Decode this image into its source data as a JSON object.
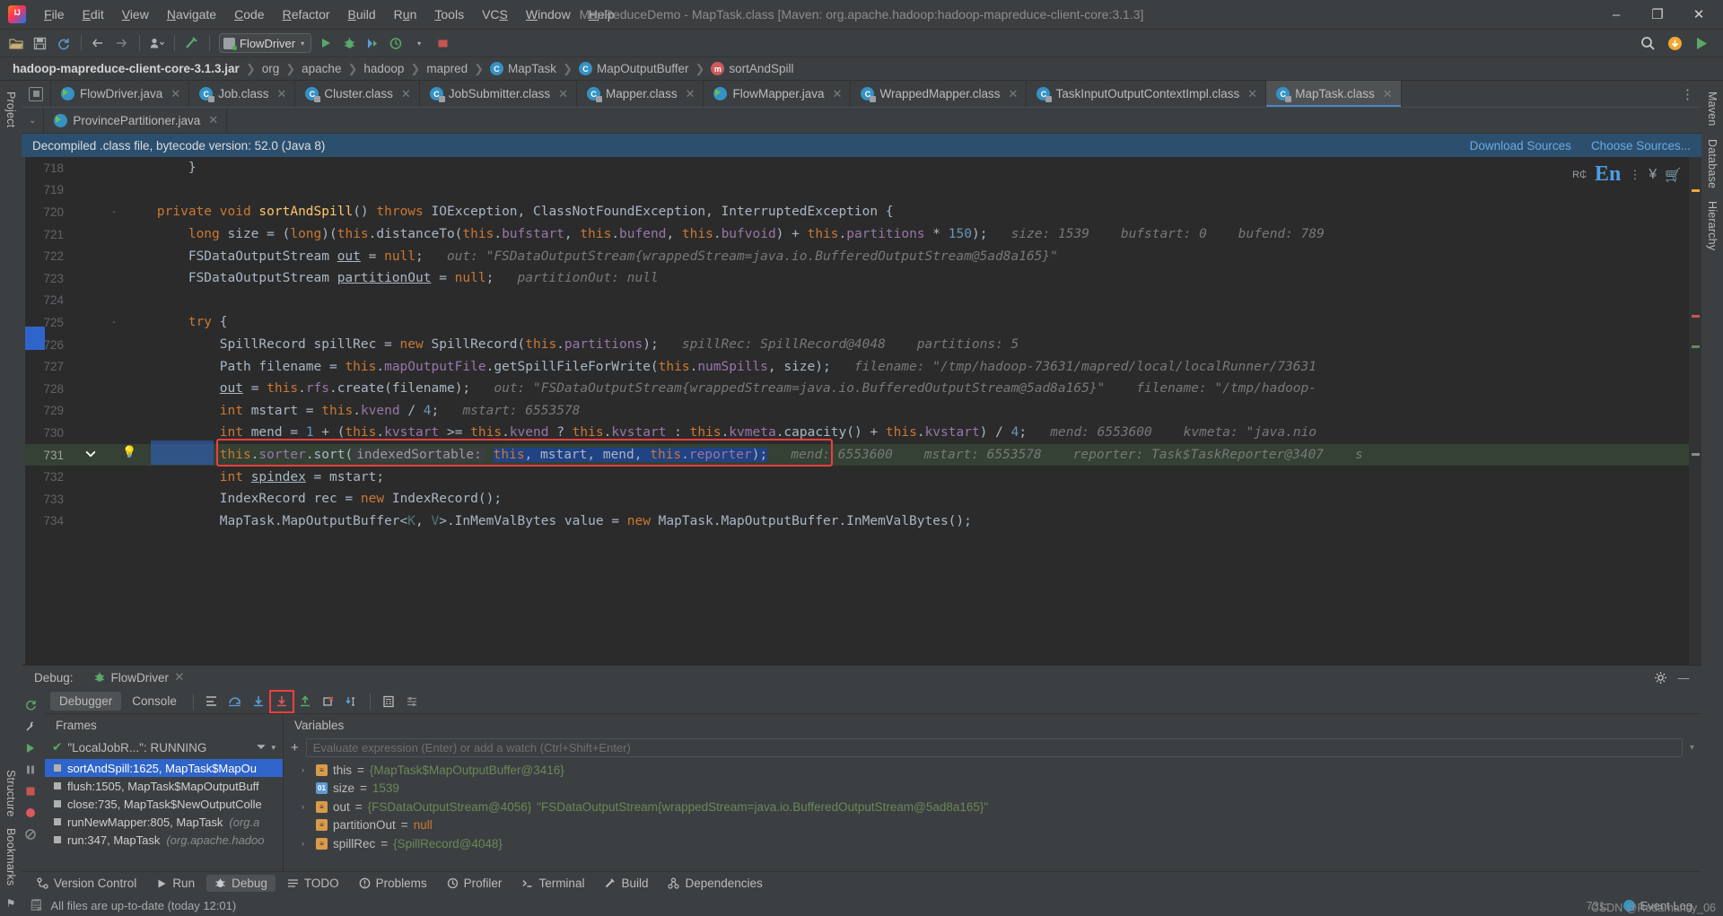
{
  "window": {
    "title": "MapReduceDemo - MapTask.class [Maven: org.apache.hadoop:hadoop-mapreduce-client-core:3.1.3]",
    "minimize": "–",
    "maximize": "❐",
    "close": "✕"
  },
  "menubar": [
    {
      "label": "File"
    },
    {
      "label": "Edit"
    },
    {
      "label": "View"
    },
    {
      "label": "Navigate"
    },
    {
      "label": "Code"
    },
    {
      "label": "Refactor"
    },
    {
      "label": "Build"
    },
    {
      "label": "Run"
    },
    {
      "label": "Tools"
    },
    {
      "label": "VCS"
    },
    {
      "label": "Window"
    },
    {
      "label": "Help"
    }
  ],
  "toolbar": {
    "run_config": "FlowDriver",
    "caret": "▾",
    "icons": [
      "open-folder-icon",
      "save-icon",
      "sync-icon",
      "back-arrow-icon",
      "forward-arrow-icon",
      "profile-icon",
      "build-hammer-icon",
      "run-icon",
      "debug-icon",
      "run-coverage-icon",
      "profiler-icon",
      "stop-icon"
    ],
    "search_icon": "⌕",
    "updates_icon": "↓",
    "plugin_icon": "▶"
  },
  "breadcrumb": [
    {
      "label": "hadoop-mapreduce-client-core-3.1.3.jar",
      "icon": null,
      "bold": true
    },
    {
      "label": "org",
      "icon": null,
      "bold": false
    },
    {
      "label": "apache",
      "icon": null,
      "bold": false
    },
    {
      "label": "hadoop",
      "icon": null,
      "bold": false
    },
    {
      "label": "mapred",
      "icon": null,
      "bold": false
    },
    {
      "label": "MapTask",
      "icon": "class-icon",
      "bold": false
    },
    {
      "label": "MapOutputBuffer",
      "icon": "class-icon",
      "bold": false
    },
    {
      "label": "sortAndSpill",
      "icon": "method-icon",
      "bold": false
    }
  ],
  "tabs_row1": [
    {
      "label": "FlowDriver.java",
      "icon": "java-file-icon",
      "active": false
    },
    {
      "label": "Job.class",
      "icon": "class-file-icon",
      "active": false
    },
    {
      "label": "Cluster.class",
      "icon": "class-file-icon",
      "active": false
    },
    {
      "label": "JobSubmitter.class",
      "icon": "class-file-icon",
      "active": false
    },
    {
      "label": "Mapper.class",
      "icon": "class-file-icon",
      "active": false
    },
    {
      "label": "FlowMapper.java",
      "icon": "java-file-icon",
      "active": false
    },
    {
      "label": "WrappedMapper.class",
      "icon": "class-file-icon",
      "active": false
    },
    {
      "label": "TaskInputOutputContextImpl.class",
      "icon": "class-file-icon",
      "active": false
    },
    {
      "label": "MapTask.class",
      "icon": "class-file-icon",
      "active": true
    }
  ],
  "tabs_row2": [
    {
      "label": "ProvincePartitioner.java",
      "icon": "java-file-icon",
      "active": false
    }
  ],
  "tabs_overflow_icon": "⋮",
  "notice": {
    "text": "Decompiled .class file, bytecode version: 52.0 (Java 8)",
    "link_download": "Download Sources",
    "link_choose": "Choose Sources..."
  },
  "editor": {
    "first_line_no": 718,
    "lines": [
      {
        "n": 718,
        "fold": "",
        "html": "        }"
      },
      {
        "n": 719,
        "fold": "",
        "html": ""
      },
      {
        "n": 720,
        "fold": "-",
        "html": "    <span class='kw'>private</span> <span class='kw'>void</span> <span class='fn'>sortAndSpill</span>() <span class='kw'>throws</span> IOException, ClassNotFoundException, InterruptedException {"
      },
      {
        "n": 721,
        "fold": "",
        "html": "        <span class='kw'>long</span> size = (<span class='kw'>long</span>)(<span class='kw'>this</span>.distanceTo(<span class='kw'>this</span>.<span class='fld'>bufstart</span>, <span class='kw'>this</span>.<span class='fld'>bufend</span>, <span class='kw'>this</span>.<span class='fld'>bufvoid</span>) + <span class='kw'>this</span>.<span class='fld'>partitions</span> * <span class='num'>150</span>);   <span class='hint'>size: 1539    bufstart: 0    bufend: 789</span>"
      },
      {
        "n": 722,
        "fold": "",
        "html": "        FSDataOutputStream <span style='text-decoration:underline'>out</span> = <span class='kw'>null</span>;   <span class='hint'>out: \"FSDataOutputStream{wrappedStream=java.io.BufferedOutputStream@5ad8a165}\"</span>"
      },
      {
        "n": 723,
        "fold": "",
        "html": "        FSDataOutputStream <span style='text-decoration:underline'>partitionOut</span> = <span class='kw'>null</span>;   <span class='hint'>partitionOut: null</span>"
      },
      {
        "n": 724,
        "fold": "",
        "html": ""
      },
      {
        "n": 725,
        "fold": "-",
        "html": "        <span class='kw'>try</span> {"
      },
      {
        "n": 726,
        "fold": "",
        "html": "            SpillRecord spillRec = <span class='kw'>new</span> SpillRecord(<span class='kw'>this</span>.<span class='fld'>partitions</span>);   <span class='hint'>spillRec: SpillRecord@4048    partitions: 5</span>"
      },
      {
        "n": 727,
        "fold": "",
        "html": "            Path filename = <span class='kw'>this</span>.<span class='fld'>mapOutputFile</span>.getSpillFileForWrite(<span class='kw'>this</span>.<span class='fld'>numSpills</span>, size);   <span class='hint'>filename: \"/tmp/hadoop-73631/mapred/local/localRunner/73631</span>"
      },
      {
        "n": 728,
        "fold": "",
        "html": "            <span style='text-decoration:underline'>out</span> = <span class='kw'>this</span>.<span class='fld'>rfs</span>.create(filename);   <span class='hint'>out: \"FSDataOutputStream{wrappedStream=java.io.BufferedOutputStream@5ad8a165}\"    filename: \"/tmp/hadoop-</span>"
      },
      {
        "n": 729,
        "fold": "",
        "html": "            <span class='kw'>int</span> mstart = <span class='kw'>this</span>.<span class='fld'>kvend</span> / <span class='num'>4</span>;   <span class='hint'>mstart: 6553578</span>"
      },
      {
        "n": 730,
        "fold": "",
        "html": "            <span class='kw'>int</span> mend = <span class='num'>1</span> + (<span class='kw'>this</span>.<span class='fld'>kvstart</span> >= <span class='kw'>this</span>.<span class='fld'>kvend</span> ? <span class='kw'>this</span>.<span class='fld'>kvstart</span> : <span class='kw'>this</span>.<span class='fld'>kvmeta</span>.capacity() + <span class='kw'>this</span>.<span class='fld'>kvstart</span>) / <span class='num'>4</span>;   <span class='hint'>mend: 6553600    kvmeta: \"java.nio</span>"
      },
      {
        "n": 731,
        "fold": "",
        "highlight": true,
        "html": "            <span class='kw'>this</span>.<span class='fld'>sorter</span>.sort(<span class='hintbox'>indexedSortable:</span> <span class='selhl'><span class='kw'>this</span>, mstart, mend, <span class='kw'>this</span>.<span class='fld'>reporter</span>);</span>   <span class='hint'>mend: 6553600    mstart: 6553578    reporter: Task$TaskReporter@3407    s</span>"
      },
      {
        "n": 732,
        "fold": "",
        "html": "            <span class='kw'>int</span> <span style='text-decoration:underline'>spindex</span> = mstart;"
      },
      {
        "n": 733,
        "fold": "",
        "html": "            IndexRecord rec = <span class='kw'>new</span> IndexRecord();"
      },
      {
        "n": 734,
        "fold": "",
        "html": "            MapTask.MapOutputBuffer&lt;<span class='gen'>K</span>, <span class='gen'>V</span>&gt;.InMemValBytes value = <span class='kw'>new</span> MapTask.MapOutputBuffer.InMemValBytes();"
      }
    ],
    "float_badges": {
      "ime_prefix": "R₵",
      "ime": "En",
      "dots": "⋮",
      "yen": "¥",
      "cart": "🛒"
    }
  },
  "debug": {
    "label": "Debug:",
    "session": "FlowDriver",
    "tabs": [
      {
        "label": "Debugger",
        "active": true
      },
      {
        "label": "Console",
        "active": false
      }
    ],
    "toolbar_icons": [
      "show-execution-point-icon",
      "step-over-icon",
      "step-into-icon",
      "force-step-into-icon",
      "step-out-icon",
      "drop-frame-icon",
      "run-to-cursor-icon",
      "evaluate-expression-icon",
      "settings-icon"
    ],
    "frames_header": "Frames",
    "thread": "\"LocalJobR...\": RUNNING",
    "frames": [
      {
        "label": "sortAndSpill:1625, MapTask$MapOu",
        "pkg": "",
        "selected": true
      },
      {
        "label": "flush:1505, MapTask$MapOutputBuff",
        "pkg": "",
        "selected": false
      },
      {
        "label": "close:735, MapTask$NewOutputColle",
        "pkg": "",
        "selected": false
      },
      {
        "label": "runNewMapper:805, MapTask ",
        "pkg": "(org.a",
        "selected": false
      },
      {
        "label": "run:347, MapTask ",
        "pkg": "(org.apache.hadoo",
        "selected": false
      }
    ],
    "variables_header": "Variables",
    "watch_placeholder": "Evaluate expression (Enter) or add a watch (Ctrl+Shift+Enter)",
    "variables": [
      {
        "expand": "›",
        "icon": "obj",
        "name": "this",
        "eq": "=",
        "value": "{MapTask$MapOutputBuffer@3416}",
        "str": ""
      },
      {
        "expand": "",
        "icon": "prim",
        "name": "size",
        "eq": "=",
        "value": "1539",
        "str": ""
      },
      {
        "expand": "›",
        "icon": "obj",
        "name": "out",
        "eq": "=",
        "value": "{FSDataOutputStream@4056}",
        "str": "\"FSDataOutputStream{wrappedStream=java.io.BufferedOutputStream@5ad8a165}\""
      },
      {
        "expand": "",
        "icon": "obj",
        "name": "partitionOut",
        "eq": "=",
        "value": "null",
        "str": "",
        "isnull": true
      },
      {
        "expand": "›",
        "icon": "obj",
        "name": "spillRec",
        "eq": "=",
        "value": "{SpillRecord@4048}",
        "str": ""
      }
    ]
  },
  "toolwindow_bar": [
    {
      "label": "Version Control",
      "icon": "vcs-icon",
      "active": false
    },
    {
      "label": "Run",
      "icon": "run-icon",
      "active": false
    },
    {
      "label": "Debug",
      "icon": "debug-icon",
      "active": true
    },
    {
      "label": "TODO",
      "icon": "todo-icon",
      "active": false
    },
    {
      "label": "Problems",
      "icon": "problems-icon",
      "active": false
    },
    {
      "label": "Profiler",
      "icon": "profiler-icon",
      "active": false
    },
    {
      "label": "Terminal",
      "icon": "terminal-icon",
      "active": false
    },
    {
      "label": "Build",
      "icon": "build-icon",
      "active": false
    },
    {
      "label": "Dependencies",
      "icon": "dependencies-icon",
      "active": false
    }
  ],
  "statusbar": {
    "message": "All files are up-to-date (today 12:01)",
    "event_log": "Event Log",
    "position": "731:",
    "watermark": "CSDN @Redamancy_06"
  },
  "rails": {
    "left_top": [
      "Project"
    ],
    "left_bottom": [
      "Structure",
      "Bookmarks"
    ],
    "right": [
      "Maven",
      "Database",
      "Hierarchy"
    ]
  },
  "colors": {
    "accent_blue": "#4a88c7",
    "notice_bg": "#2d4f6e",
    "highlight_red": "#f03e3e",
    "selection_blue": "#214283",
    "frame_selected": "#2f65ca",
    "editor_bg": "#2b2b2b",
    "chrome_bg": "#3c3f41"
  }
}
